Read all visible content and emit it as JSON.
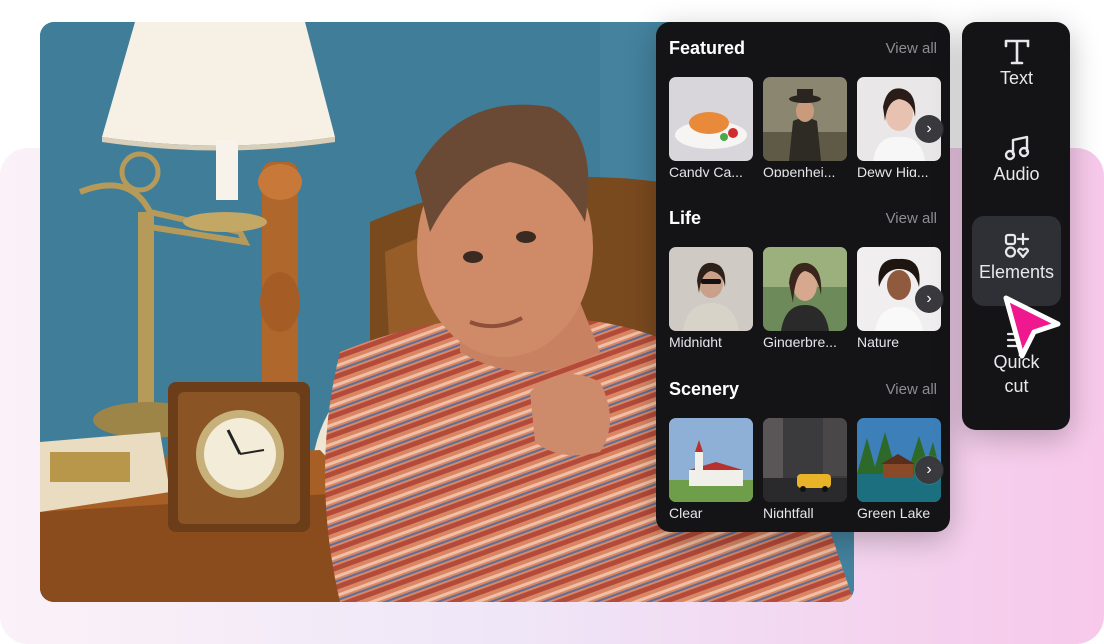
{
  "sections": [
    {
      "title": "Featured",
      "view_all": "View all",
      "items": [
        {
          "label": "Candy Ca..."
        },
        {
          "label": "Oppenhei..."
        },
        {
          "label": "Dewy Hig..."
        }
      ]
    },
    {
      "title": "Life",
      "view_all": "View all",
      "items": [
        {
          "label": "Midnight"
        },
        {
          "label": "Gingerbre..."
        },
        {
          "label": "Nature"
        }
      ]
    },
    {
      "title": "Scenery",
      "view_all": "View all",
      "items": [
        {
          "label": "Clear"
        },
        {
          "label": "Nightfall"
        },
        {
          "label": "Green Lake"
        }
      ]
    }
  ],
  "tools": [
    {
      "label": "Text",
      "icon": "text-icon"
    },
    {
      "label": "Audio",
      "icon": "music-note-icon"
    },
    {
      "label": "Elements",
      "icon": "elements-icon",
      "active": true
    },
    {
      "label_line1": "Quick",
      "label_line2": "cut",
      "icon": "quick-cut-icon"
    }
  ],
  "colors": {
    "panel_bg": "#141416",
    "accent_cursor": "#f0188f",
    "active_tool_bg": "#2f3036"
  },
  "next_glyph": "›"
}
